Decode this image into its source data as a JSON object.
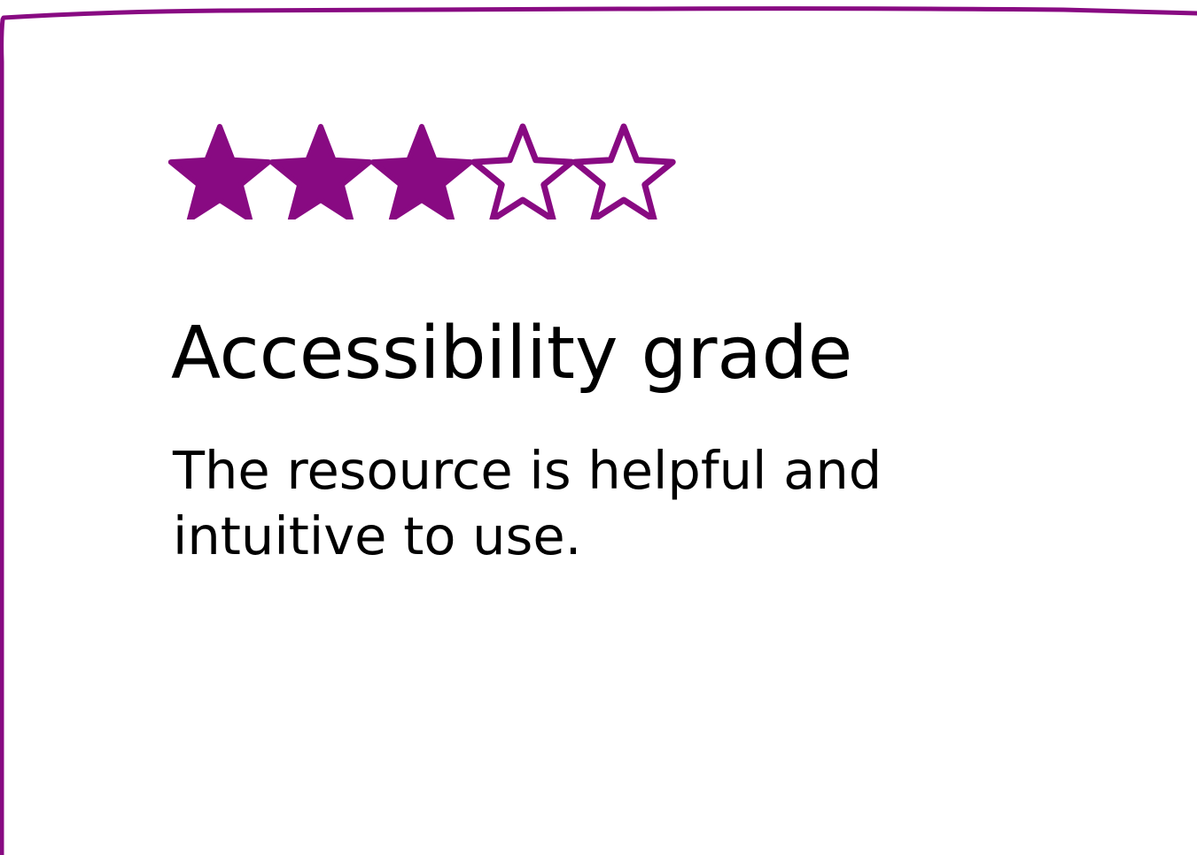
{
  "card": {
    "title": "Accessibility grade",
    "description": "The resource is helpful and intuitive to use."
  },
  "rating": {
    "value": 3,
    "max": 5
  },
  "colors": {
    "accent": "#880a82",
    "text": "#000000",
    "background": "#ffffff"
  },
  "icons": {
    "filled": "star-filled-icon",
    "empty": "star-outline-icon"
  }
}
